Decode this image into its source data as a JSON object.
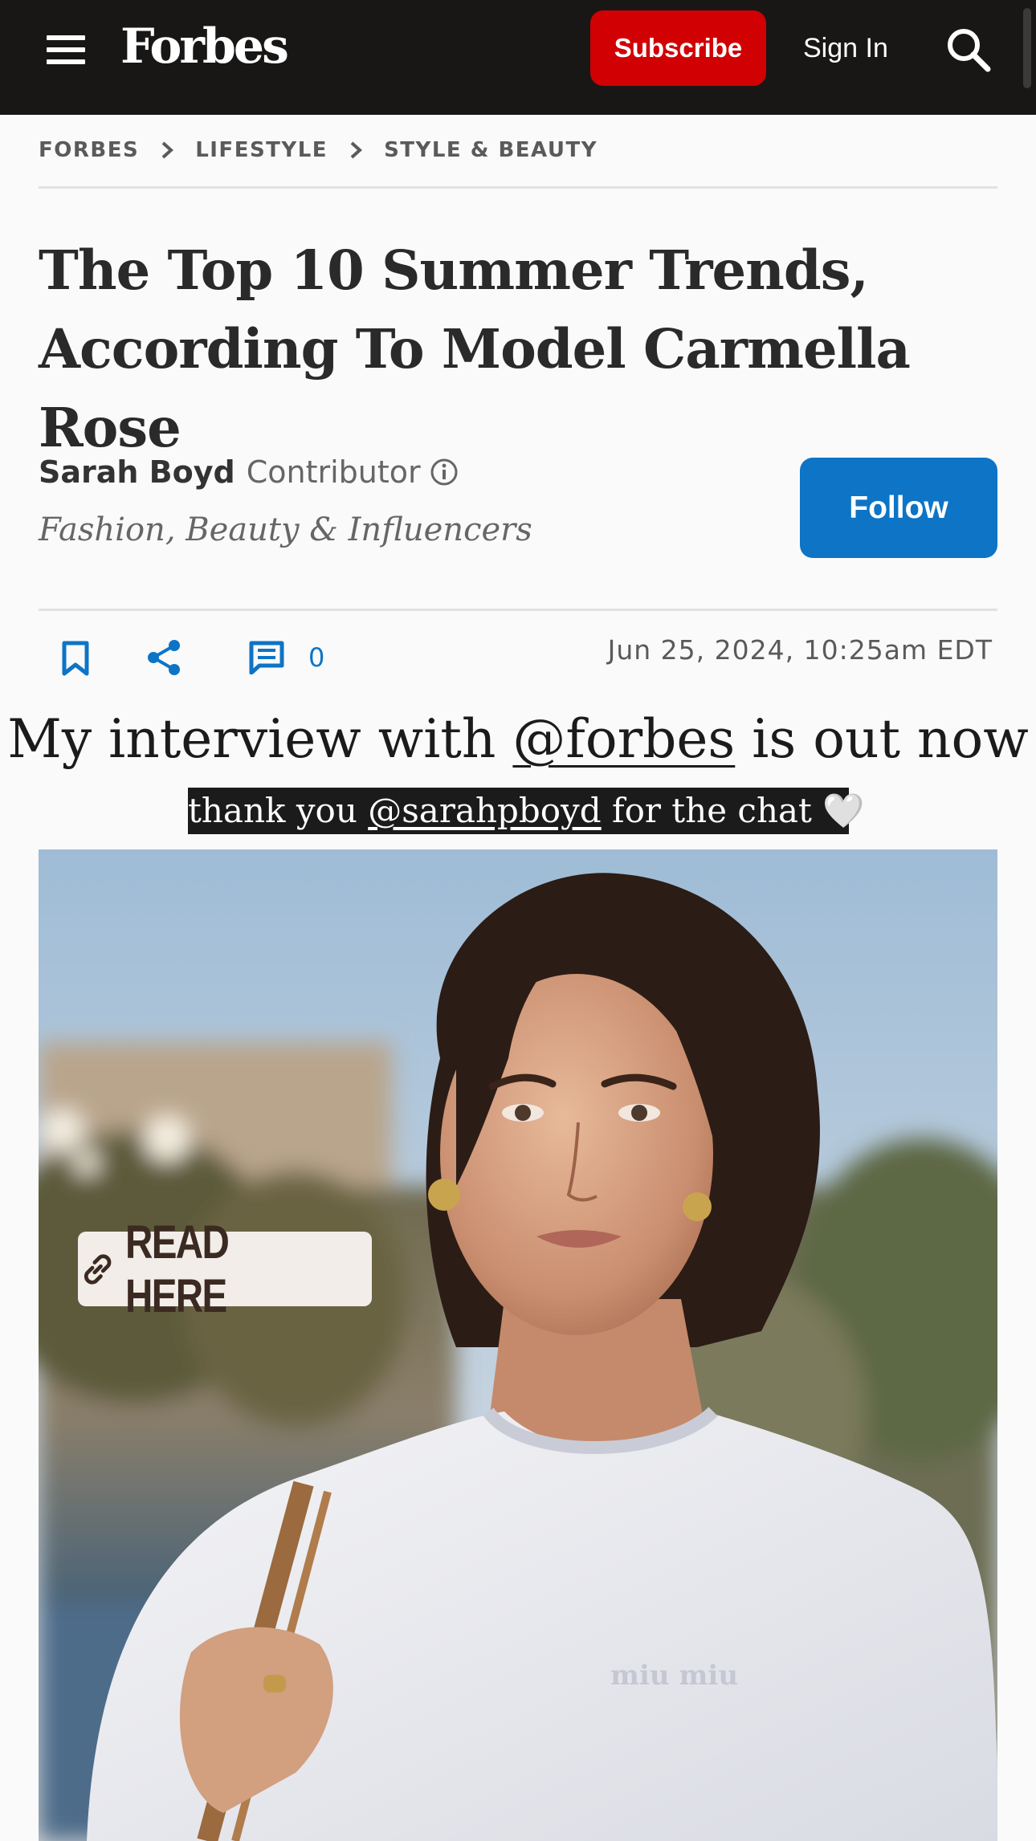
{
  "header": {
    "logo": "Forbes",
    "subscribe_label": "Subscribe",
    "signin_label": "Sign In"
  },
  "breadcrumb": [
    "FORBES",
    "LIFESTYLE",
    "STYLE & BEAUTY"
  ],
  "article": {
    "title_line1": "The Top 10 Summer Trends,",
    "title_line2": "According To Model Carmella Rose",
    "author": "Sarah Boyd",
    "author_role": "Contributor",
    "author_beat": "Fashion, Beauty & Influencers",
    "follow_label": "Follow",
    "comment_count": "0",
    "date": "Jun 25, 2024, 10:25am EDT"
  },
  "story": {
    "line1_pre": "My interview with ",
    "line1_handle": "@forbes",
    "line1_post": " is out now",
    "line2_pre": "thank you ",
    "line2_handle": "@sarahpboyd",
    "line2_post": " for the chat 🤍",
    "link_sticker": "READ HERE"
  },
  "icons": [
    "menu-icon",
    "search-icon",
    "chevron-right-icon",
    "info-icon",
    "bookmark-icon",
    "share-icon",
    "comment-icon",
    "link-icon"
  ],
  "colors": {
    "topbar": "#181716",
    "subscribe": "#d10003",
    "accent_blue": "#0d74c6"
  }
}
